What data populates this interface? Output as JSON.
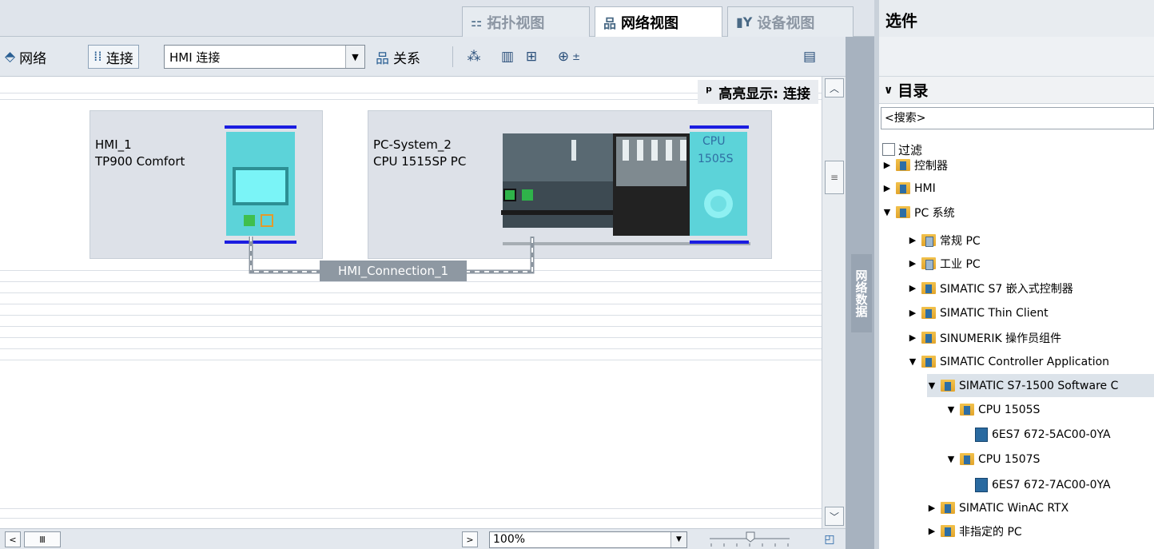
{
  "view_tabs": [
    {
      "label": "拓扑视图",
      "icon": "topology-icon",
      "active": false
    },
    {
      "label": "网络视图",
      "icon": "network-view-icon",
      "active": true
    },
    {
      "label": "设备视图",
      "icon": "device-view-icon",
      "active": false
    }
  ],
  "toolbar": {
    "network_label": "网络",
    "connection_label": "连接",
    "connection_type_value": "HMI 连接",
    "relation_label": "关系"
  },
  "highlight": {
    "label": "高亮显示: 连接"
  },
  "devices": [
    {
      "name": "HMI_1",
      "type": "TP900 Comfort"
    },
    {
      "name": "PC-System_2",
      "type": "CPU 1515SP PC",
      "cpu_label_1": "CPU",
      "cpu_label_2": "1505S"
    }
  ],
  "connection": {
    "label": "HMI_Connection_1"
  },
  "side_tab": {
    "label": "网络数据"
  },
  "zoom": {
    "value": "100%"
  },
  "catalog": {
    "title": "选件",
    "header": "目录",
    "search_placeholder": "<搜索>",
    "filter_label": "过滤",
    "tree": [
      {
        "label": "控制器",
        "expanded": false,
        "icon": "folder-icon"
      },
      {
        "label": "HMI",
        "expanded": false,
        "icon": "folder-icon"
      },
      {
        "label": "PC 系统",
        "expanded": true,
        "icon": "folder-icon"
      },
      {
        "label": "常规 PC",
        "expanded": false,
        "icon": "pc-folder-icon"
      },
      {
        "label": "工业 PC",
        "expanded": false,
        "icon": "pc-folder-icon"
      },
      {
        "label": "SIMATIC S7 嵌入式控制器",
        "expanded": false,
        "icon": "folder-icon"
      },
      {
        "label": "SIMATIC Thin Client",
        "expanded": false,
        "icon": "folder-icon"
      },
      {
        "label": "SINUMERIK 操作员组件",
        "expanded": false,
        "icon": "folder-icon"
      },
      {
        "label": "SIMATIC Controller Application",
        "expanded": true,
        "icon": "folder-icon"
      },
      {
        "label": "SIMATIC S7-1500 Software C",
        "expanded": true,
        "icon": "folder-icon",
        "selected": true
      },
      {
        "label": "CPU 1505S",
        "expanded": true,
        "icon": "folder-icon"
      },
      {
        "label": "6ES7 672-5AC00-0YA",
        "icon": "module-icon"
      },
      {
        "label": "CPU 1507S",
        "expanded": true,
        "icon": "folder-icon"
      },
      {
        "label": "6ES7 672-7AC00-0YA",
        "icon": "module-icon"
      },
      {
        "label": "SIMATIC WinAC RTX",
        "expanded": false,
        "icon": "folder-icon"
      },
      {
        "label": "非指定的 PC",
        "expanded": false,
        "icon": "folder-icon"
      }
    ]
  }
}
